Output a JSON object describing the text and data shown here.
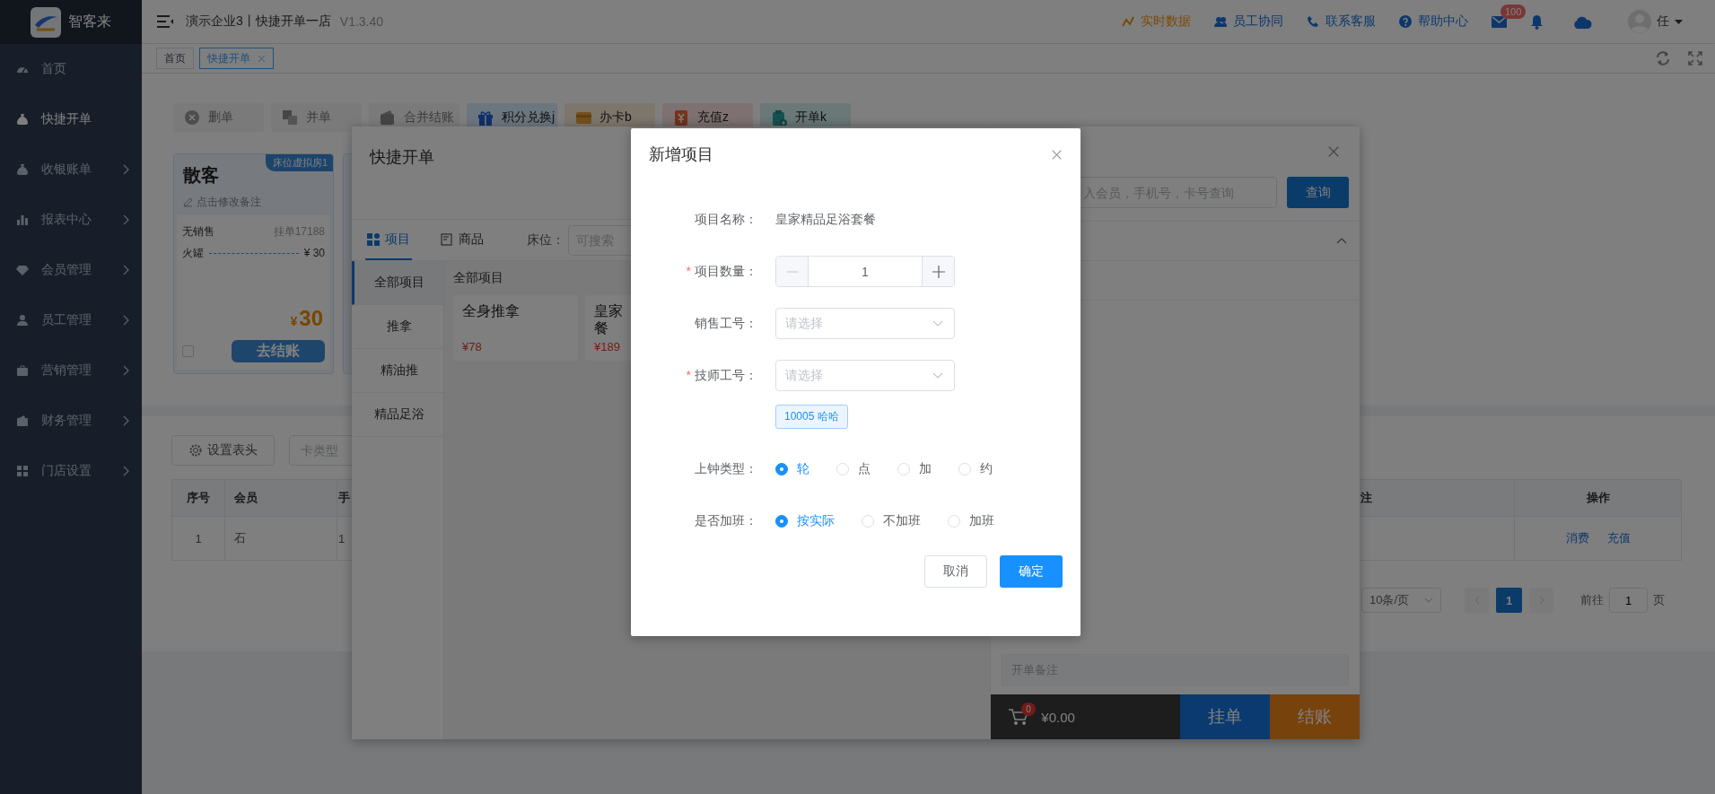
{
  "sidebar": {
    "logo_text": "智客来",
    "items": [
      {
        "label": "首页",
        "selected": false,
        "expandable": false
      },
      {
        "label": "快捷开单",
        "selected": true,
        "expandable": false
      },
      {
        "label": "收银账单",
        "selected": false,
        "expandable": true
      },
      {
        "label": "报表中心",
        "selected": false,
        "expandable": true
      },
      {
        "label": "会员管理",
        "selected": false,
        "expandable": true
      },
      {
        "label": "员工管理",
        "selected": false,
        "expandable": true
      },
      {
        "label": "营销管理",
        "selected": false,
        "expandable": true
      },
      {
        "label": "财务管理",
        "selected": false,
        "expandable": true
      },
      {
        "label": "门店设置",
        "selected": false,
        "expandable": true
      }
    ]
  },
  "header": {
    "title": "演示企业3丨快捷开单一店",
    "version": "V1.3.40",
    "links": [
      {
        "label": "实时数据",
        "highlighted": true
      },
      {
        "label": "员工协同",
        "highlighted": false
      },
      {
        "label": "联系客服",
        "highlighted": false
      },
      {
        "label": "帮助中心",
        "highlighted": false
      }
    ],
    "mail_badge": "100",
    "user_name": "任"
  },
  "tags": [
    {
      "label": "首页",
      "selected": false,
      "closable": false
    },
    {
      "label": "快捷开单",
      "selected": true,
      "closable": true
    }
  ],
  "toolbar": [
    {
      "label": "删单",
      "kind": "delete"
    },
    {
      "label": "并单",
      "kind": "merge"
    },
    {
      "label": "合并结账",
      "kind": "merge-pay"
    },
    {
      "label": "积分兑换j",
      "kind": "points"
    },
    {
      "label": "办卡b",
      "kind": "card"
    },
    {
      "label": "充值z",
      "kind": "recharge"
    },
    {
      "label": "开单k",
      "kind": "open"
    }
  ],
  "orders": [
    {
      "customer": "散客",
      "bed": "床位虚拟房1",
      "note": "点击修改备注",
      "seller": "无销售",
      "order_no": "挂单17188",
      "items": [
        {
          "name": "火罐",
          "price": "¥ 30"
        }
      ],
      "currency": "¥",
      "total": "30",
      "checked": false,
      "action": "去结账"
    }
  ],
  "member_table": {
    "settings_button": "设置表头",
    "filter_placeholder": "卡类型",
    "columns": [
      "序号",
      "会员",
      "手",
      "注",
      "操作"
    ],
    "rows": [
      {
        "index": "1",
        "member": "石",
        "column_3": "1",
        "actions": [
          "消费",
          "充值"
        ]
      }
    ],
    "pagination": {
      "page_size": "10条/页",
      "pages": [
        {
          "label": "1",
          "selected": true
        }
      ],
      "goto_label": "前往",
      "goto_value": "1",
      "suffix": "页"
    }
  },
  "quick_order": {
    "title": "快捷开单",
    "tabs": [
      {
        "label": "项目",
        "selected": true
      },
      {
        "label": "商品",
        "selected": false
      }
    ],
    "bed_label": "床位：",
    "bed_placeholder": "可搜索",
    "categories": [
      {
        "label": "全部项目",
        "selected": true
      },
      {
        "label": "推拿",
        "selected": false
      },
      {
        "label": "精油推",
        "selected": false
      },
      {
        "label": "精品足浴",
        "selected": false
      }
    ],
    "section_title": "全部项目",
    "products": [
      {
        "name_lines": [
          "全身推拿"
        ],
        "price": "¥78"
      },
      {
        "name_lines": [
          "皇家",
          "餐"
        ],
        "price": "¥189"
      }
    ],
    "search_placeholder": "入会员，手机号，卡号查询",
    "search_button": "查询",
    "member_section_expanded": true,
    "note_placeholder": "开单备注",
    "cart_count": "0",
    "amount": "¥0.00",
    "hold_button": "挂单",
    "checkout_button": "结账"
  },
  "add_item_modal": {
    "title": "新增项目",
    "fields": [
      {
        "kind": "text",
        "label": "项目名称：",
        "value": "皇家精品足浴套餐"
      },
      {
        "kind": "stepper",
        "label": "项目数量：",
        "required_mark": "*",
        "value": "1",
        "decrease_disabled": true
      },
      {
        "kind": "select",
        "label": "销售工号：",
        "placeholder": "请选择"
      },
      {
        "kind": "select",
        "label": "技师工号：",
        "required_mark": "*",
        "placeholder": "请选择",
        "tags": [
          "10005 哈哈"
        ]
      },
      {
        "kind": "radio",
        "label": "上钟类型：",
        "options": [
          {
            "label": "轮",
            "selected": true
          },
          {
            "label": "点",
            "selected": false
          },
          {
            "label": "加",
            "selected": false
          },
          {
            "label": "约",
            "selected": false
          }
        ]
      },
      {
        "kind": "radio",
        "label": "是否加班：",
        "options": [
          {
            "label": "按实际",
            "selected": true
          },
          {
            "label": "不加班",
            "selected": false
          },
          {
            "label": "加班",
            "selected": false
          }
        ]
      }
    ],
    "cancel_button": "取消",
    "confirm_button": "确定"
  }
}
